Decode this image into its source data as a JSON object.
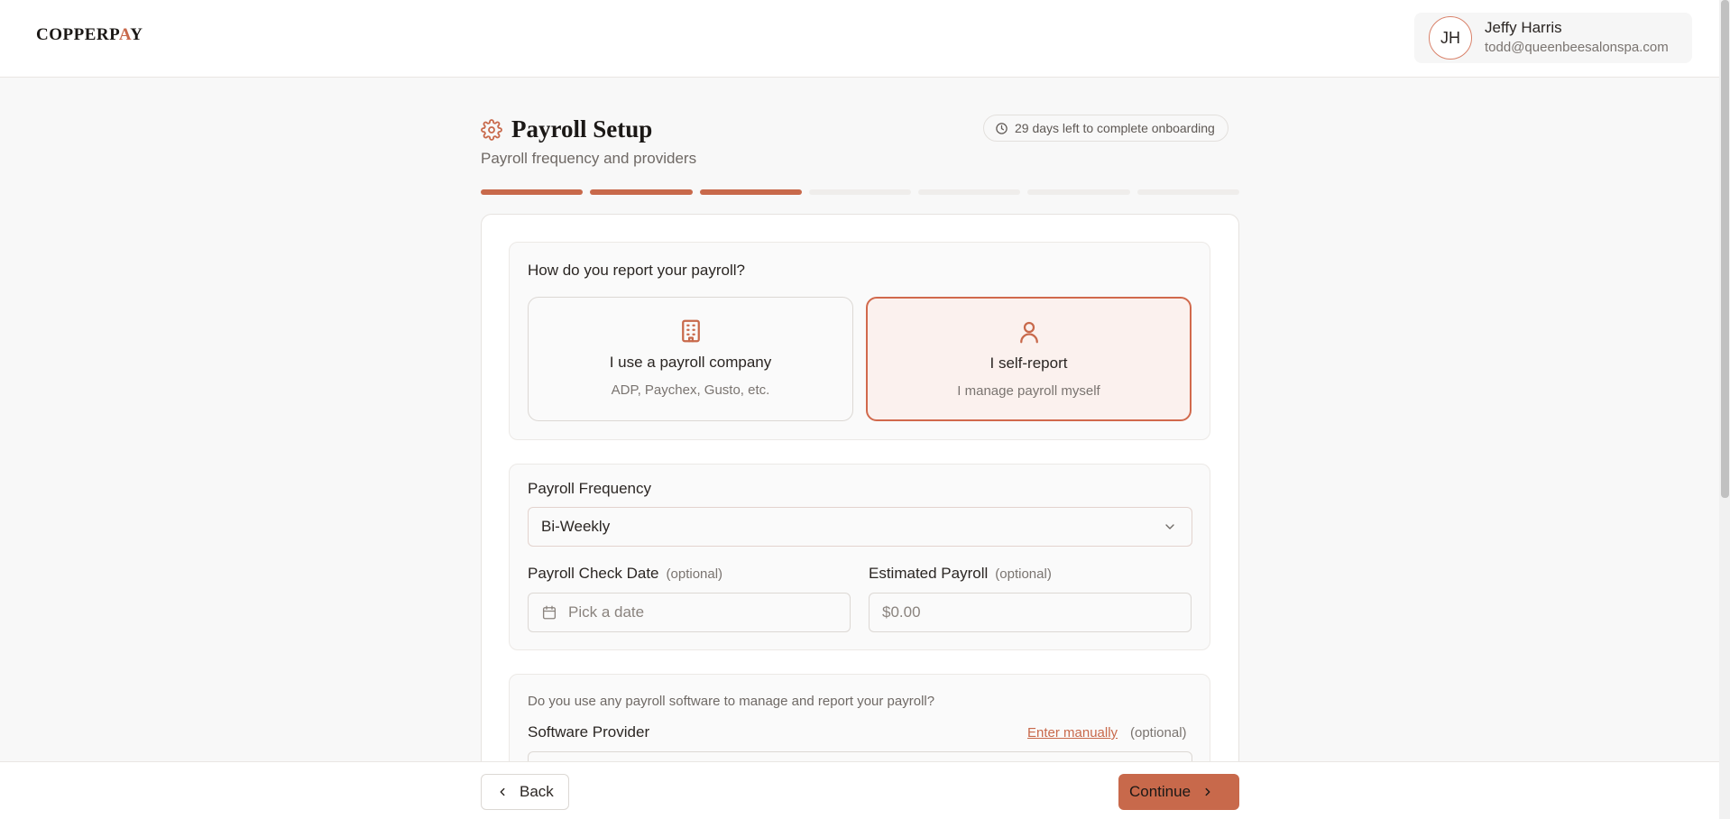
{
  "brand": {
    "logo_text_a": "COPPERP",
    "logo_text_b": "A",
    "logo_text_c": "Y"
  },
  "user": {
    "initials": "JH",
    "name": "Jeffy Harris",
    "email": "todd@queenbeesalonspa.com"
  },
  "page": {
    "title": "Payroll Setup",
    "subtitle": "Payroll frequency and providers",
    "deadline": "29 days left to complete onboarding",
    "progress": {
      "completed_steps": 3,
      "total_steps": 7
    }
  },
  "report": {
    "question": "How do you report your payroll?",
    "options": [
      {
        "title": "I use a payroll company",
        "subtitle": "ADP, Paychex, Gusto, etc.",
        "selected": false
      },
      {
        "title": "I self-report",
        "subtitle": "I manage payroll myself",
        "selected": true
      }
    ]
  },
  "frequency": {
    "label": "Payroll Frequency",
    "value": "Bi-Weekly"
  },
  "check_date": {
    "label": "Payroll Check Date",
    "optional": "(optional)",
    "placeholder": "Pick a date"
  },
  "estimated": {
    "label": "Estimated Payroll",
    "optional": "(optional)",
    "placeholder": "$0.00"
  },
  "software": {
    "question": "Do you use any payroll software to manage and report your payroll?",
    "label": "Software Provider",
    "link": "Enter manually",
    "optional": "(optional)"
  },
  "footer": {
    "back": "Back",
    "continue": "Continue"
  },
  "colors": {
    "accent": "#c8694b",
    "selected_bg": "#fbf1ee"
  }
}
